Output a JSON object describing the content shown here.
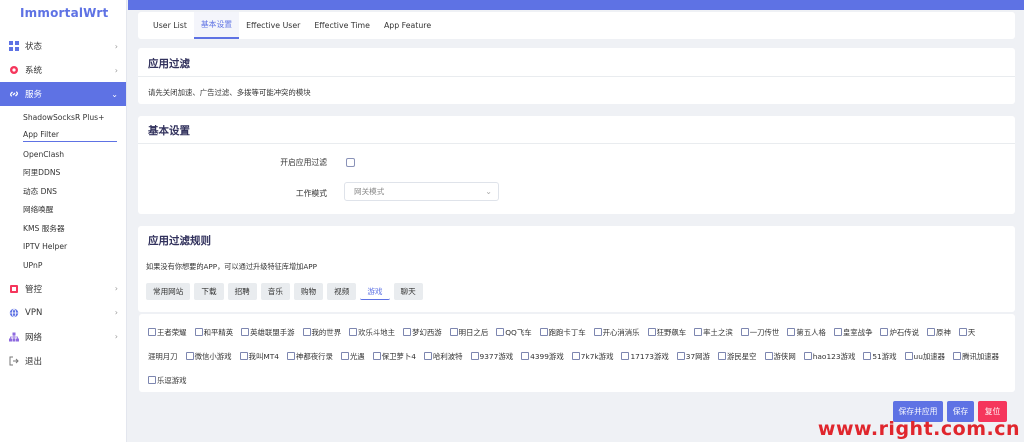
{
  "app": {
    "logo": "ImmortalWrt"
  },
  "colors": {
    "accent": "#5e72e4",
    "danger": "#f5365c",
    "watermark": "#e0262d"
  },
  "sidebar": {
    "items": [
      {
        "label": "状态",
        "icon": "dashboard-icon"
      },
      {
        "label": "系统",
        "icon": "gear-icon"
      },
      {
        "label": "服务",
        "icon": "link-icon",
        "active": true
      },
      {
        "label": "管控",
        "icon": "control-icon"
      },
      {
        "label": "VPN",
        "icon": "globe-icon"
      },
      {
        "label": "网络",
        "icon": "network-icon"
      },
      {
        "label": "退出",
        "icon": "logout-icon"
      }
    ],
    "subitems": [
      "ShadowSocksR Plus+",
      "App Filter",
      "OpenClash",
      "阿里DDNS",
      "动态 DNS",
      "网络唤醒",
      "KMS 服务器",
      "IPTV Helper",
      "UPnP"
    ]
  },
  "tabs": [
    "User List",
    "基本设置",
    "Effective User",
    "Effective Time",
    "App Feature"
  ],
  "intro": {
    "title": "应用过滤",
    "desc": "请先关闭加速、广告过滤、多拨等可能冲突的模块"
  },
  "basic": {
    "title": "基本设置",
    "enable_label": "开启应用过滤",
    "mode_label": "工作模式",
    "mode_value": "网关模式"
  },
  "rules": {
    "title": "应用过滤规则",
    "hint": "如果没有你想要的APP，可以通过升级特征库增加APP",
    "categories": [
      "常用网站",
      "下载",
      "招聘",
      "音乐",
      "购物",
      "视频",
      "游戏",
      "聊天"
    ],
    "active_category": "游戏",
    "apps_row1": [
      "王者荣耀",
      "和平精英",
      "英雄联盟手游",
      "我的世界",
      "欢乐斗地主",
      "梦幻西游",
      "明日之后",
      "QQ飞车",
      "跑跑卡丁车",
      "开心消消乐",
      "狂野飙车",
      "率土之滨",
      "一刀传世",
      "第五人格",
      "皇室战争",
      "炉石传说",
      "原神",
      "天"
    ],
    "apps_row2_first": "涯明月刀",
    "apps_row2": [
      "微信小游戏",
      "我叫MT4",
      "神都夜行录",
      "光遇",
      "保卫萝卜4",
      "哈利波特",
      "9377游戏",
      "4399游戏",
      "7k7k游戏",
      "17173游戏",
      "37网游",
      "游民星空",
      "游侠网",
      "hao123游戏",
      "51游戏",
      "uu加速器",
      "腾讯加速器"
    ],
    "apps_row3": [
      "乐逗游戏"
    ]
  },
  "buttons": {
    "save_apply": "保存并应用",
    "save": "保存",
    "reset": "复位"
  },
  "watermark": "www.right.com.cn"
}
